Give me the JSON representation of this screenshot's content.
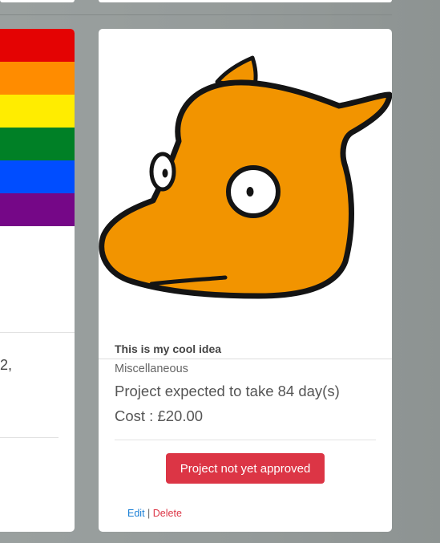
{
  "left_card": {
    "stripe_colors": [
      "#e40303",
      "#ff8c00",
      "#ffed00",
      "#008026",
      "#004dff",
      "#750787"
    ],
    "cut_off_text": "2,"
  },
  "project_card": {
    "image_icon": "orange-creature-drawing",
    "title": "This is my cool idea",
    "category": "Miscellaneous",
    "duration_text": "Project expected to take 84 day(s)",
    "cost_text": "Cost : £20.00",
    "status_button_label": "Project not yet approved",
    "edit_label": "Edit",
    "separator": "|",
    "delete_label": "Delete"
  },
  "colors": {
    "danger": "#dc3545",
    "link": "#1a7fd6",
    "creature_fill": "#f29400",
    "creature_outline": "#141414"
  }
}
